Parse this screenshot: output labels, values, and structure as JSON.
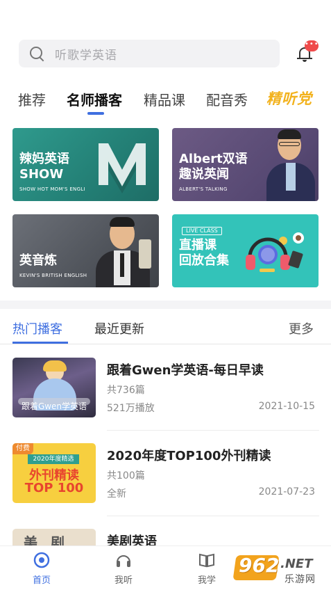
{
  "search": {
    "placeholder": "听歌学英语"
  },
  "notifications": {
    "badge": "•••"
  },
  "tabs": [
    {
      "label": "推荐"
    },
    {
      "label": "名师播客"
    },
    {
      "label": "精品课"
    },
    {
      "label": "配音秀"
    },
    {
      "label": "精听党"
    }
  ],
  "cards": [
    {
      "title_line1": "辣妈英语",
      "title_line2": "SHOW",
      "subtitle": "SHOW HOT MOM'S ENGLI"
    },
    {
      "title_line1": "Albert双语",
      "title_line2": "趣说英闻",
      "subtitle": "ALBERT'S TALKING"
    },
    {
      "title_line1": "英音炼",
      "subtitle": "KEVIN'S BRITISH ENGLISH"
    },
    {
      "badge": "LIVE CLASS",
      "title_line1": "直播课",
      "title_line2": "回放合集"
    }
  ],
  "subtabs": {
    "hot": "热门播客",
    "recent": "最近更新",
    "more": "更多"
  },
  "list": [
    {
      "title": "跟着Gwen学英语-每日早读",
      "count": "共736篇",
      "plays": "521万播放",
      "date": "2021-10-15",
      "thumb_caption": "跟着Gwen学英语"
    },
    {
      "title": "2020年度TOP100外刊精读",
      "count": "共100篇",
      "plays": "全新",
      "date": "2021-07-23",
      "thumb_tag": "付费",
      "thumb_line1": "2020年度精选",
      "thumb_line2": "外刊精读",
      "thumb_line3": "TOP 100"
    },
    {
      "title": "美剧英语",
      "thumb_text": "美 剧"
    }
  ],
  "nav": [
    {
      "label": "首页",
      "icon": "home-icon"
    },
    {
      "label": "我听",
      "icon": "headphones-icon"
    },
    {
      "label": "我学",
      "icon": "book-icon"
    }
  ],
  "watermark": {
    "line1": "962",
    "line2": ".NET",
    "line3": "乐游网"
  },
  "colors": {
    "accent": "#3f6fe0",
    "badge": "#ef4b4b",
    "gold": "#f2b21d"
  }
}
